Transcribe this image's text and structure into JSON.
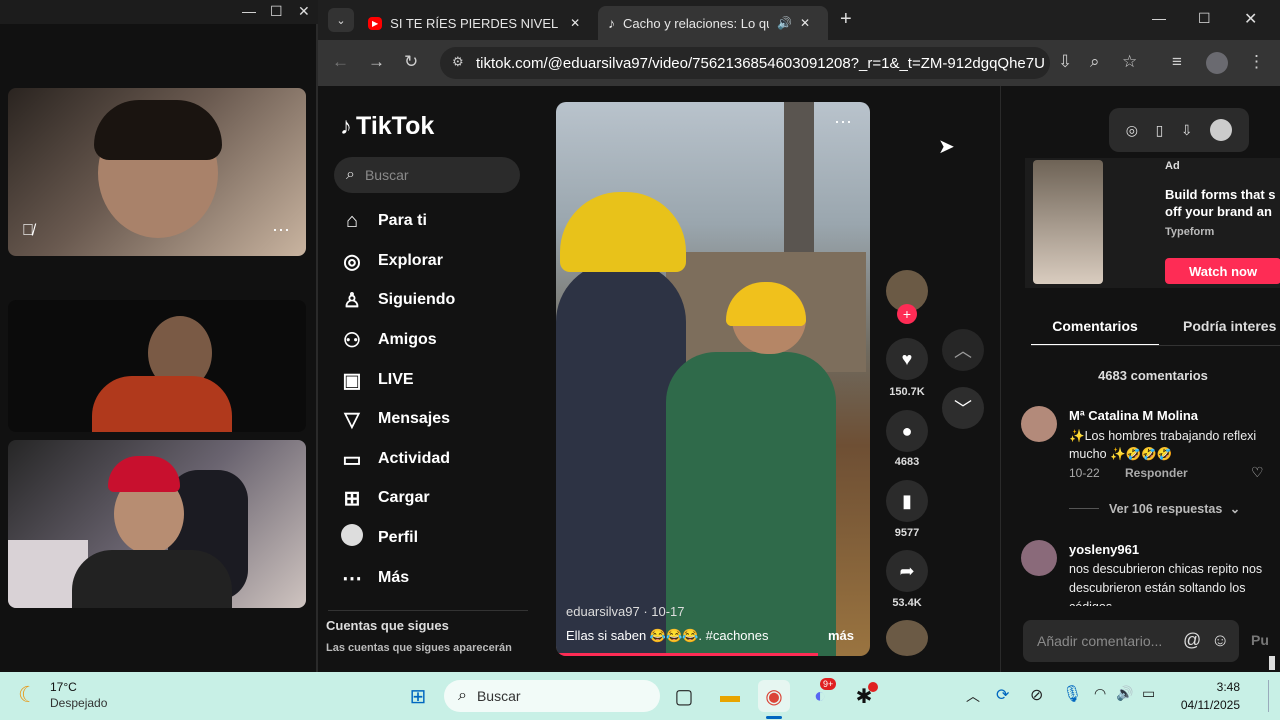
{
  "browser": {
    "tabs": [
      {
        "title": "SI TE RÍES PIERDES NIVEL DIOS (",
        "icon": "youtube-icon"
      },
      {
        "title": "Cacho y relaciones: Lo que ",
        "icon": "tiktok-icon"
      }
    ],
    "url": "tiktok.com/@eduarsilva97/video/7562136854603091208?_r=1&_t=ZM-912dgqQhe7U"
  },
  "tiktok": {
    "brand": "TikTok",
    "search_placeholder": "Buscar",
    "nav": [
      {
        "label": "Para ti",
        "icon": "home-icon"
      },
      {
        "label": "Explorar",
        "icon": "compass-icon"
      },
      {
        "label": "Siguiendo",
        "icon": "following-icon"
      },
      {
        "label": "Amigos",
        "icon": "friends-icon"
      },
      {
        "label": "LIVE",
        "icon": "live-icon"
      },
      {
        "label": "Mensajes",
        "icon": "messages-icon"
      },
      {
        "label": "Actividad",
        "icon": "activity-icon"
      },
      {
        "label": "Cargar",
        "icon": "upload-icon"
      },
      {
        "label": "Perfil",
        "icon": "profile-icon"
      },
      {
        "label": "Más",
        "icon": "more-icon"
      }
    ],
    "following_heading": "Cuentas que sigues",
    "following_sub": "Las cuentas que sigues aparecerán",
    "video": {
      "author_date": "eduarsilva97 · 10-17",
      "caption": "Ellas si saben 😂😂😂. #cachones",
      "more": "más"
    },
    "actions": {
      "likes": "150.7K",
      "comments": "4683",
      "saves": "9577",
      "shares": "53.4K"
    },
    "ad": {
      "label": "Ad",
      "title": "Build forms that s off your brand an",
      "advertiser": "Typeform",
      "cta": "Watch now"
    },
    "panel_tabs": [
      "Comentarios",
      "Podría interes"
    ],
    "comment_count": "4683 comentarios",
    "comments": [
      {
        "user": "Mª Catalina M Molina",
        "text": "✨Los hombres trabajando reflexi mucho ✨🤣🤣🤣",
        "date": "10-22",
        "reply": "Responder",
        "replies": "Ver 106 respuestas"
      },
      {
        "user": "yosleny961",
        "text": "nos descubrieron chicas repito nos descubrieron están soltando los códigos"
      }
    ],
    "comment_input_placeholder": "Añadir comentario...",
    "post_label": "Pu"
  },
  "taskbar": {
    "weather_temp": "17°C",
    "weather_desc": "Despejado",
    "search_label": "Buscar",
    "time": "3:48",
    "date": "04/11/2025",
    "discord_badge": "9+"
  },
  "colors": {
    "tiktok_pink": "#fe2c55",
    "taskbar_bg": "#c8f0e6"
  }
}
